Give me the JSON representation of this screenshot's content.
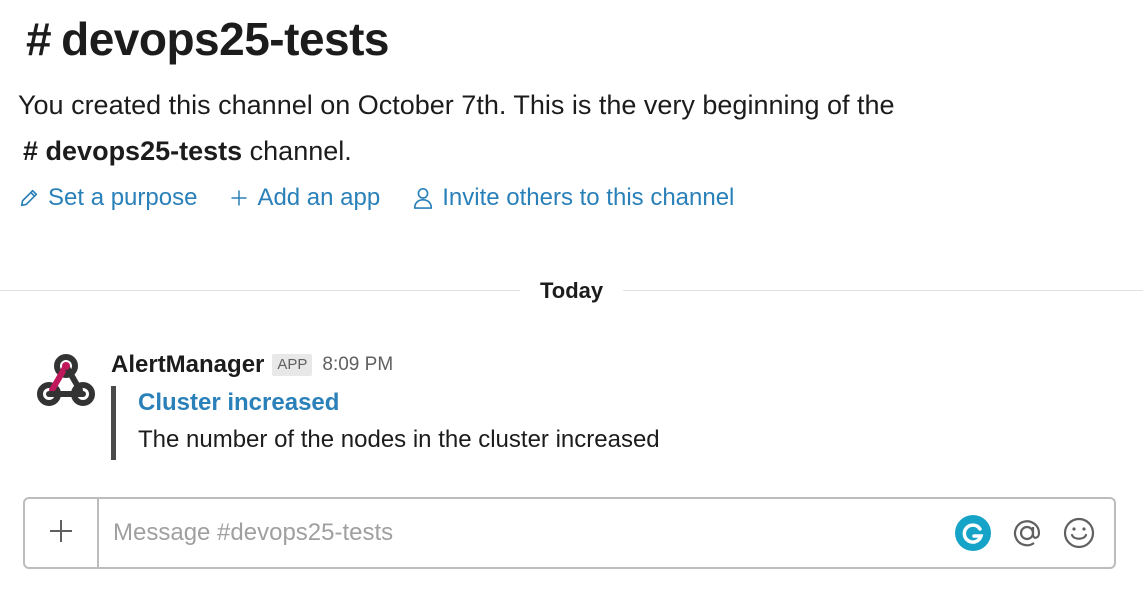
{
  "channel": {
    "hash": "#",
    "name": "devops25-tests"
  },
  "intro": {
    "text_before": "You created this channel on October 7th. This is the very beginning of the",
    "channel_hash": "#",
    "channel_name": "devops25-tests",
    "text_after": "channel."
  },
  "actions": [
    {
      "label": "Set a purpose",
      "icon": "pencil-icon"
    },
    {
      "label": "Add an app",
      "icon": "plus-icon"
    },
    {
      "label": "Invite others to this channel",
      "icon": "user-icon"
    }
  ],
  "divider": {
    "label": "Today"
  },
  "message": {
    "author": "AlertManager",
    "badge": "APP",
    "time": "8:09 PM",
    "avatar_icon": "webhook-icon",
    "attachment": {
      "title": "Cluster increased",
      "text": "The number of the nodes in the cluster increased",
      "bar_color": "#4a4a4a"
    }
  },
  "composer": {
    "placeholder": "Message #devops25-tests",
    "value": "",
    "icons": [
      "grammarly-icon",
      "at-icon",
      "emoji-icon"
    ]
  },
  "colors": {
    "link": "#2a80b9",
    "text": "#1d1c1d",
    "muted": "#616061",
    "grammarly": "#15a3c7"
  }
}
